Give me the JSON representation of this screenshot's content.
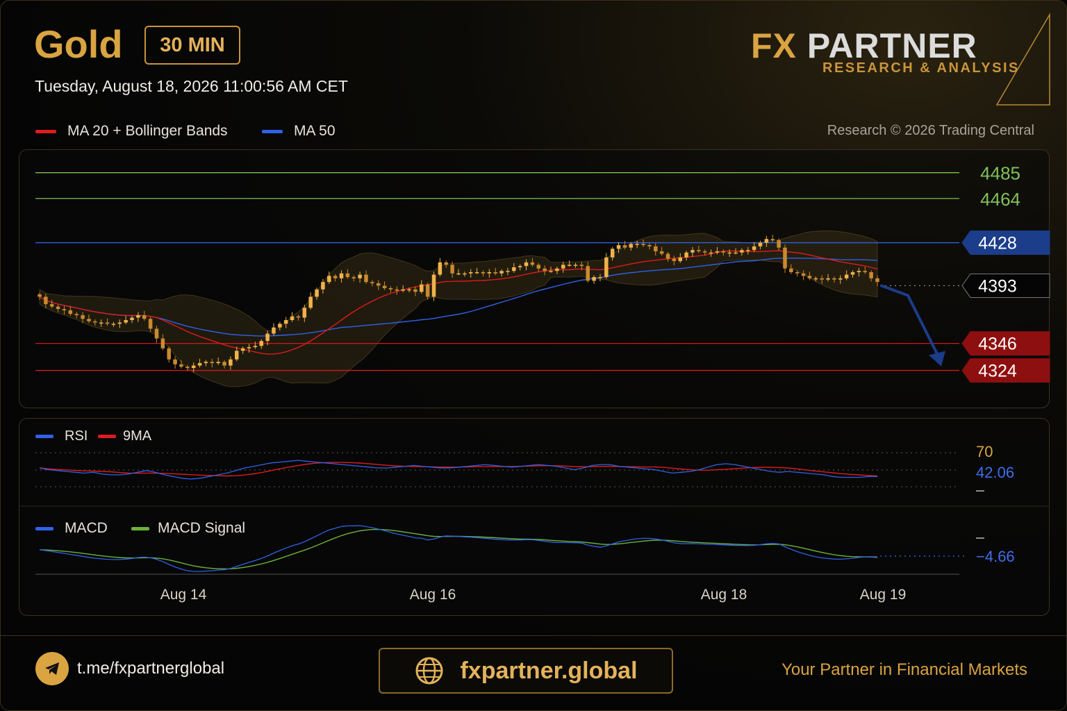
{
  "header": {
    "title": "Gold",
    "timeframe": "30 MIN",
    "datetime": "Tuesday, August 18, 2026 11:00:56 AM CET",
    "brand_fx": "FX",
    "brand_partner": "PARTNER",
    "brand_sub": "RESEARCH & ANALYSIS",
    "credit": "Research © 2026 Trading Central"
  },
  "legend": {
    "ma20": "MA 20 + Bollinger Bands",
    "ma50": "MA 50",
    "rsi": "RSI",
    "rsi_ma": "9MA",
    "macd": "MACD",
    "macd_signal": "MACD Signal"
  },
  "colors": {
    "gold": "#d9a441",
    "bull_candle": "#f0b24a",
    "ma20": "#e01b1b",
    "ma50": "#2f62e6",
    "resistance": "#7fc25a",
    "support": "#d11a1a",
    "pivot": "#1b3d8a",
    "macd_signal": "#6ab23a"
  },
  "footer": {
    "telegram": "t.me/fxpartnerglobal",
    "website": "fxpartner.global",
    "slogan": "Your Partner in Financial Markets"
  },
  "chart_data": [
    {
      "type": "candlestick",
      "x_tick_labels": [
        "Aug 14",
        "Aug 16",
        "Aug 18",
        "Aug 19"
      ],
      "ylim": [
        4300,
        4495
      ],
      "levels": [
        {
          "value": 4485,
          "label": "4485",
          "kind": "resistance"
        },
        {
          "value": 4464,
          "label": "4464",
          "kind": "resistance"
        },
        {
          "value": 4428,
          "label": "4428",
          "kind": "pivot"
        },
        {
          "value": 4393,
          "label": "4393",
          "kind": "current"
        },
        {
          "value": 4346,
          "label": "4346",
          "kind": "support"
        },
        {
          "value": 4324,
          "label": "4324",
          "kind": "support"
        }
      ],
      "close": [
        4384,
        4378,
        4376,
        4374,
        4373,
        4370,
        4369,
        4366,
        4364,
        4363,
        4363,
        4362,
        4362,
        4363,
        4365,
        4367,
        4369,
        4366,
        4358,
        4350,
        4342,
        4333,
        4329,
        4327,
        4326,
        4328,
        4330,
        4331,
        4330,
        4331,
        4328,
        4333,
        4340,
        4342,
        4343,
        4344,
        4348,
        4354,
        4359,
        4362,
        4365,
        4368,
        4367,
        4375,
        4384,
        4390,
        4396,
        4401,
        4399,
        4403,
        4400,
        4399,
        4402,
        4396,
        4395,
        4393,
        4391,
        4390,
        4389,
        4390,
        4390,
        4388,
        4394,
        4384,
        4402,
        4412,
        4410,
        4403,
        4403,
        4403,
        4404,
        4404,
        4403,
        4404,
        4403,
        4405,
        4405,
        4408,
        4409,
        4412,
        4410,
        4407,
        4405,
        4405,
        4407,
        4410,
        4410,
        4410,
        4409,
        4397,
        4400,
        4400,
        4416,
        4423,
        4426,
        4424,
        4427,
        4427,
        4426,
        4425,
        4421,
        4419,
        4415,
        4413,
        4416,
        4420,
        4422,
        4421,
        4420,
        4420,
        4421,
        4420,
        4420,
        4420,
        4422,
        4422,
        4425,
        4428,
        4431,
        4430,
        4424,
        4407,
        4404,
        4403,
        4401,
        4399,
        4399,
        4398,
        4399,
        4398,
        4399,
        4402,
        4404,
        4405,
        4404,
        4399,
        4396
      ]
    },
    {
      "type": "line",
      "title": "RSI",
      "series": [
        {
          "name": "RSI"
        },
        {
          "name": "9MA"
        }
      ],
      "y_tick_labels": [
        "70"
      ],
      "last_value": "42.06",
      "rsi": [
        52,
        50,
        49,
        48,
        47,
        46,
        47,
        45,
        44,
        44,
        45,
        47,
        49,
        47,
        44,
        42,
        40,
        39,
        40,
        42,
        44,
        46,
        49,
        52,
        54,
        56,
        58,
        59,
        60,
        61,
        60,
        59,
        58,
        57,
        56,
        55,
        54,
        53,
        52,
        52,
        53,
        54,
        55,
        54,
        53,
        52,
        52,
        53,
        54,
        55,
        56,
        55,
        54,
        53,
        54,
        55,
        56,
        55,
        54,
        52,
        50,
        52,
        55,
        56,
        56,
        54,
        53,
        52,
        51,
        50,
        48,
        46,
        47,
        48,
        50,
        53,
        56,
        57,
        56,
        54,
        52,
        50,
        48,
        47,
        48,
        47,
        46,
        45,
        44,
        42,
        41,
        41,
        41,
        42,
        42
      ]
    },
    {
      "type": "line",
      "title": "MACD",
      "series": [
        {
          "name": "MACD"
        },
        {
          "name": "MACD Signal"
        }
      ],
      "last_value": "−4.66"
    }
  ]
}
